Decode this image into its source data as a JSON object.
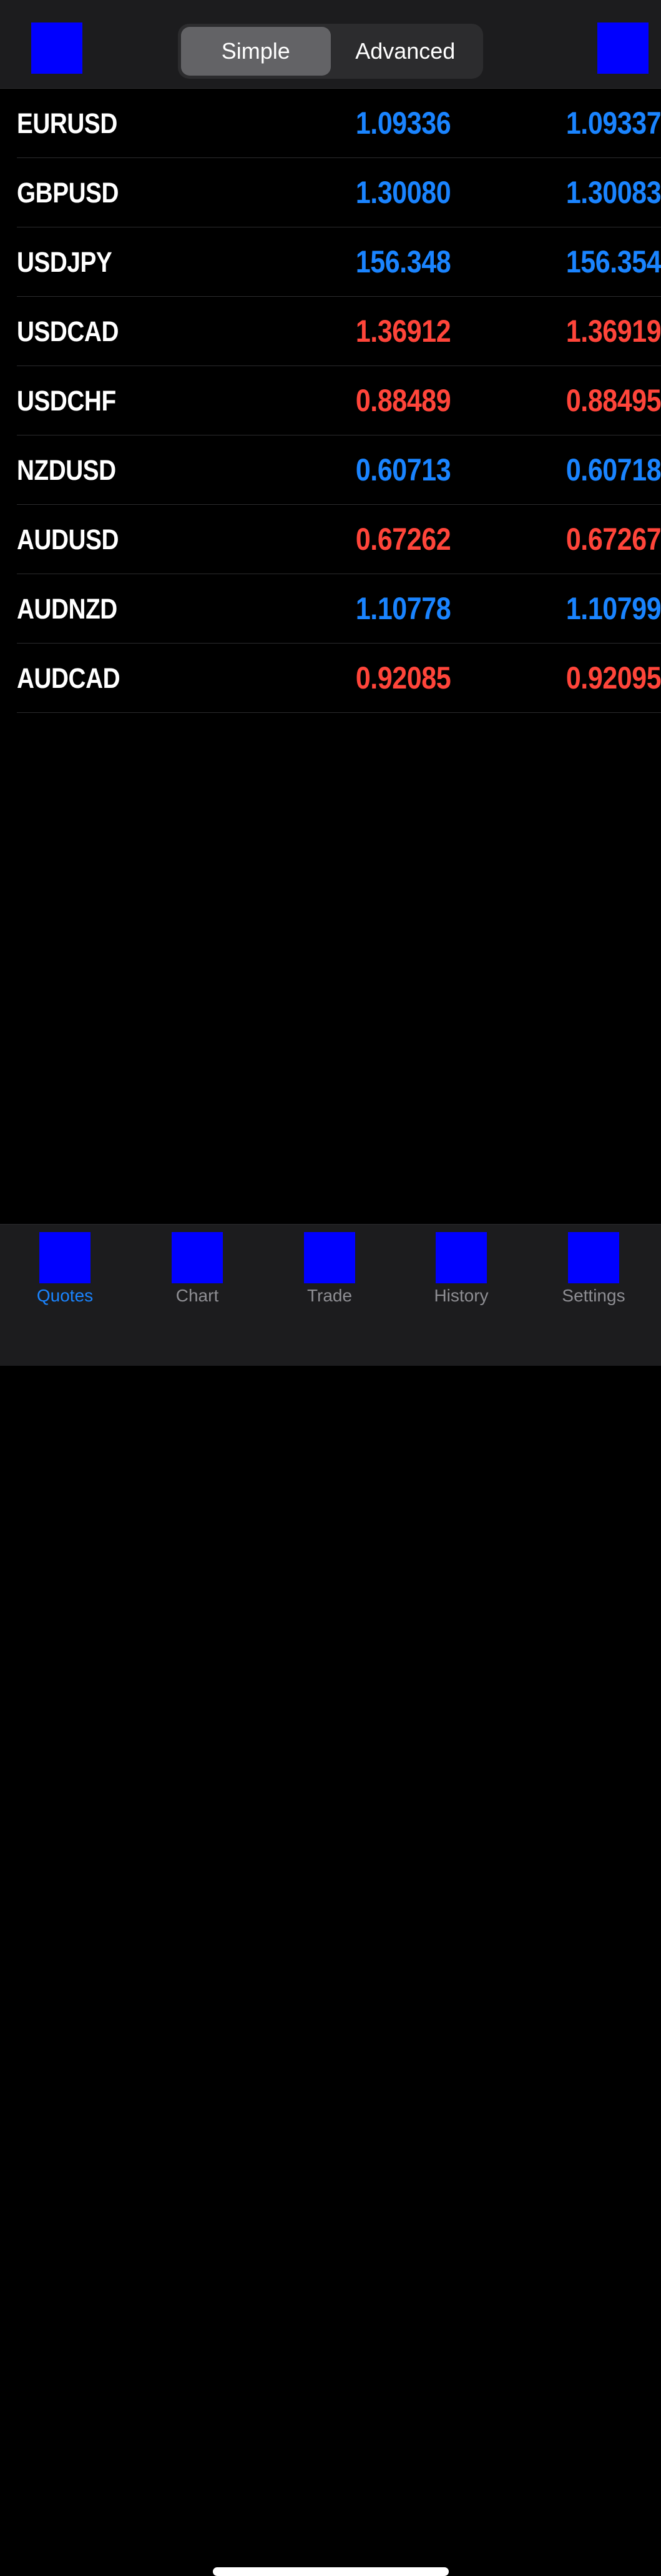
{
  "header": {
    "left_icon": "blue-square-icon",
    "right_icon": "blue-square-icon",
    "segments": [
      "Simple",
      "Advanced"
    ],
    "selected_segment": "Simple"
  },
  "colors": {
    "up": "#1a84ff",
    "down": "#ff453a",
    "background": "#000000",
    "bar": "#1c1c1e",
    "icon_placeholder": "#0000ff"
  },
  "quotes": [
    {
      "symbol": "EURUSD",
      "bid": "1.09336",
      "ask": "1.09337",
      "direction": "up"
    },
    {
      "symbol": "GBPUSD",
      "bid": "1.30080",
      "ask": "1.30083",
      "direction": "up"
    },
    {
      "symbol": "USDJPY",
      "bid": "156.348",
      "ask": "156.354",
      "direction": "up"
    },
    {
      "symbol": "USDCAD",
      "bid": "1.36912",
      "ask": "1.36919",
      "direction": "down"
    },
    {
      "symbol": "USDCHF",
      "bid": "0.88489",
      "ask": "0.88495",
      "direction": "down"
    },
    {
      "symbol": "NZDUSD",
      "bid": "0.60713",
      "ask": "0.60718",
      "direction": "up"
    },
    {
      "symbol": "AUDUSD",
      "bid": "0.67262",
      "ask": "0.67267",
      "direction": "down"
    },
    {
      "symbol": "AUDNZD",
      "bid": "1.10778",
      "ask": "1.10799",
      "direction": "up"
    },
    {
      "symbol": "AUDCAD",
      "bid": "0.92085",
      "ask": "0.92095",
      "direction": "down"
    }
  ],
  "tabbar": {
    "active": "Quotes",
    "tabs": [
      {
        "label": "Quotes",
        "icon": "quotes-icon"
      },
      {
        "label": "Chart",
        "icon": "chart-icon"
      },
      {
        "label": "Trade",
        "icon": "trade-icon"
      },
      {
        "label": "History",
        "icon": "history-icon"
      },
      {
        "label": "Settings",
        "icon": "settings-icon"
      }
    ]
  }
}
